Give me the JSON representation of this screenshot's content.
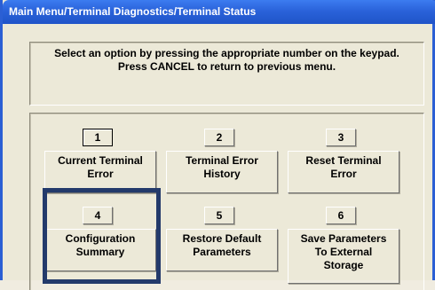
{
  "window": {
    "title": "Main Menu/Terminal Diagnostics/Terminal Status"
  },
  "message": {
    "line1": "Select an option by pressing the appropriate number on the keypad.",
    "line2": "Press CANCEL to return to previous menu."
  },
  "options": [
    {
      "number": "1",
      "line1": "Current Terminal",
      "line2": "Error",
      "line3": ""
    },
    {
      "number": "2",
      "line1": "Terminal Error",
      "line2": "History",
      "line3": ""
    },
    {
      "number": "3",
      "line1": "Reset Terminal",
      "line2": "Error",
      "line3": ""
    },
    {
      "number": "4",
      "line1": "Configuration",
      "line2": "Summary",
      "line3": ""
    },
    {
      "number": "5",
      "line1": "Restore Default",
      "line2": "Parameters",
      "line3": ""
    },
    {
      "number": "6",
      "line1": "Save Parameters",
      "line2": "To External",
      "line3": "Storage"
    }
  ],
  "highlight_color": "#233a6b",
  "titlebar_color": "#2a62da"
}
